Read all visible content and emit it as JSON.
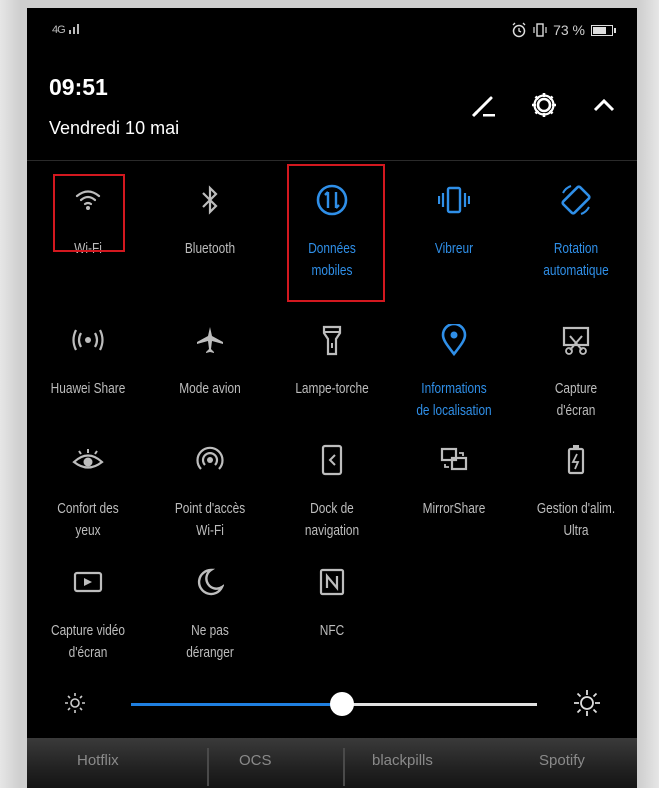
{
  "status": {
    "signal_text": "4G",
    "battery": "73 %",
    "battery_level": 0.73
  },
  "header": {
    "time": "09:51",
    "date": "Vendredi 10 mai"
  },
  "header_icons": [
    "edit-icon",
    "gear-icon",
    "chevron-up-icon"
  ],
  "toggles": [
    {
      "line1": "Wi-Fi",
      "line2": "",
      "icon": "wifi-icon",
      "active": false
    },
    {
      "line1": "Bluetooth",
      "line2": "",
      "icon": "bluetooth-icon",
      "active": false
    },
    {
      "line1": "Données",
      "line2": "mobiles",
      "icon": "mobile-data-icon",
      "active": true
    },
    {
      "line1": "Vibreur",
      "line2": "",
      "icon": "vibrate-icon",
      "active": true
    },
    {
      "line1": "Rotation",
      "line2": "automatique",
      "icon": "auto-rotate-icon",
      "active": true
    },
    {
      "line1": "Huawei Share",
      "line2": "",
      "icon": "huawei-share-icon",
      "active": false
    },
    {
      "line1": "Mode avion",
      "line2": "",
      "icon": "airplane-icon",
      "active": false
    },
    {
      "line1": "Lampe-torche",
      "line2": "",
      "icon": "flashlight-icon",
      "active": false
    },
    {
      "line1": "Informations",
      "line2": "de localisation",
      "icon": "location-icon",
      "active": true
    },
    {
      "line1": "Capture",
      "line2": "d'écran",
      "icon": "screenshot-icon",
      "active": false
    },
    {
      "line1": "Confort des",
      "line2": "yeux",
      "icon": "eye-comfort-icon",
      "active": false
    },
    {
      "line1": "Point d'accès",
      "line2": "Wi-Fi",
      "icon": "hotspot-icon",
      "active": false
    },
    {
      "line1": "Dock de",
      "line2": "navigation",
      "icon": "navigation-dock-icon",
      "active": false
    },
    {
      "line1": "MirrorShare",
      "line2": "",
      "icon": "mirrorshare-icon",
      "active": false
    },
    {
      "line1": "Gestion d'alim.",
      "line2": "Ultra",
      "icon": "power-saving-icon",
      "active": false
    },
    {
      "line1": "Capture vidéo",
      "line2": "d'écran",
      "icon": "screen-record-icon",
      "active": false
    },
    {
      "line1": "Ne pas",
      "line2": "déranger",
      "icon": "do-not-disturb-icon",
      "active": false
    },
    {
      "line1": "NFC",
      "line2": "",
      "icon": "nfc-icon",
      "active": false
    }
  ],
  "brightness": {
    "level": 0.52
  },
  "dock_apps": [
    "Hotflix",
    "OCS",
    "blackpills",
    "Spotify"
  ],
  "colors": {
    "active": "#2f8fe8",
    "inactive": "#bdbdbd",
    "highlight": "#d3181f",
    "slider": "#1f7fe0"
  }
}
